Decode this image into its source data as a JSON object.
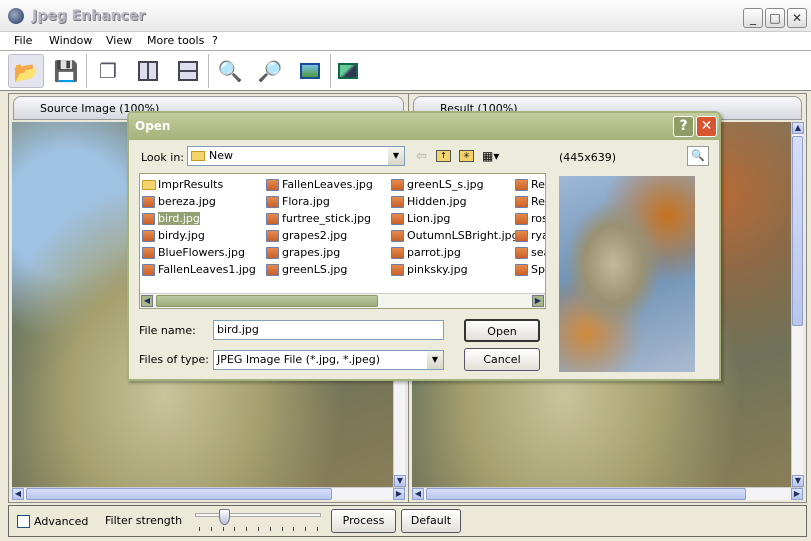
{
  "app": {
    "title": "Jpeg Enhancer"
  },
  "menu": [
    "File",
    "Window",
    "View",
    "More tools",
    "?"
  ],
  "toolbar": {
    "open": "open-folder-icon",
    "save": "floppy-disk-icon",
    "cascade": "cascade-windows-icon",
    "tile_vertical": "tile-vertical-icon",
    "tile_horizontal": "tile-horizontal-icon",
    "zoom_in": "zoom-in-icon",
    "zoom_out": "zoom-out-icon",
    "fit": "fit-to-window-icon",
    "edit": "edit-image-icon"
  },
  "panels": {
    "source_tab": "Source Image (100%)",
    "result_tab": "Result (100%)"
  },
  "bottom": {
    "advanced_label": "Advanced",
    "advanced_checked": false,
    "filter_label": "Filter strength",
    "filter_value_percent": 20,
    "process_label": "Process",
    "default_label": "Default"
  },
  "dialog": {
    "title": "Open",
    "look_in_label": "Look in:",
    "look_in_value": "New",
    "image_size": "(445x639)",
    "files": [
      [
        "ImprResults",
        "bereza.jpg",
        "bird.jpg",
        "birdy.jpg",
        "BlueFlowers.jpg",
        "FallenLeaves1.jpg"
      ],
      [
        "FallenLeaves.jpg",
        "Flora.jpg",
        "furtree_stick.jpg",
        "grapes2.jpg",
        "grapes.jpg",
        "greenLS.jpg"
      ],
      [
        "greenLS_s.jpg",
        "Hidden.jpg",
        "Lion.jpg",
        "OutumnLSBright.jpg",
        "parrot.jpg",
        "pinksky.jpg"
      ],
      [
        "Re",
        "Re",
        "ros",
        "rya",
        "sea",
        "Spr"
      ]
    ],
    "selected_file": "bird.jpg",
    "file_name_label": "File name:",
    "file_name_value": "bird.jpg",
    "files_of_type_label": "Files of type:",
    "files_of_type_value": "JPEG Image File (*.jpg, *.jpeg)",
    "open_label": "Open",
    "cancel_label": "Cancel",
    "help_label": "?",
    "close_label": "✕"
  }
}
